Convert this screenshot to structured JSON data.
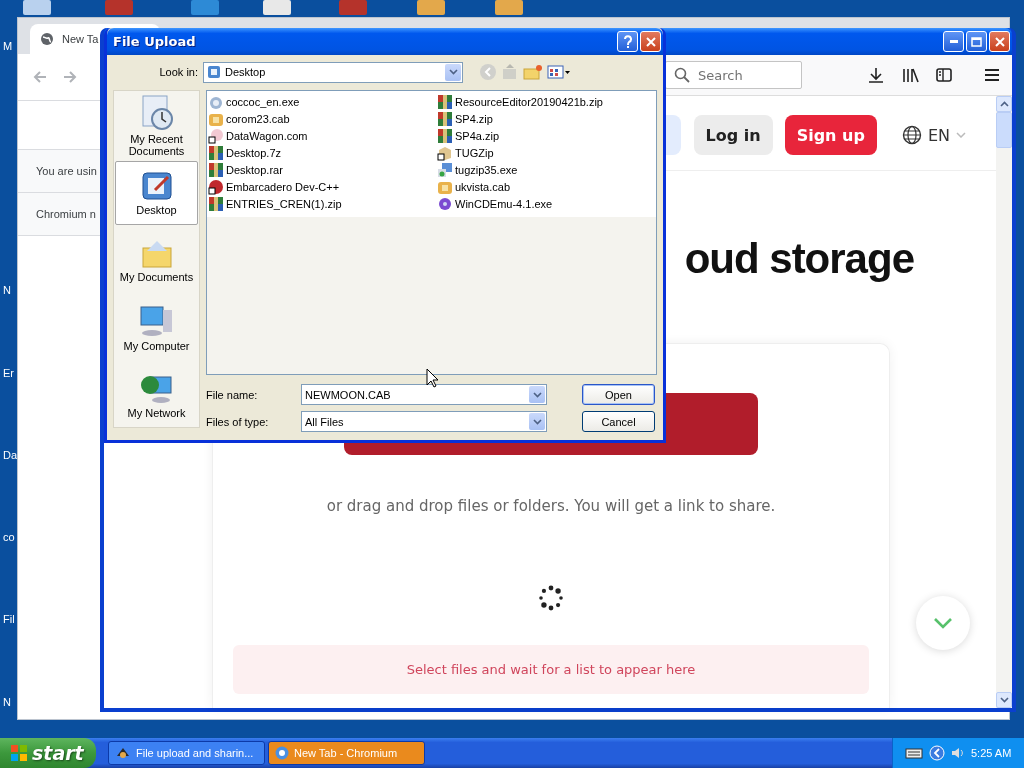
{
  "desktop": {
    "icon_labels": [
      "M",
      "N",
      "Er",
      "Da",
      "co",
      "Fil",
      "N"
    ]
  },
  "back_window": {
    "tab": {
      "label": "New Ta",
      "selected": true
    },
    "infobar_text": "You are usin",
    "notice_text": "Chromium n"
  },
  "browser": {
    "search": {
      "placeholder": "Search"
    },
    "login": "Log in",
    "signup": "Sign up",
    "language": "EN",
    "heading": "oud storage",
    "drop_hint": "or drag and drop files or folders. You will get a link to share.",
    "empty_list": "Select files and wait for a list to appear here"
  },
  "dialog": {
    "title": "File Upload",
    "look_in_label": "Look in:",
    "look_in_value": "Desktop",
    "places": [
      {
        "label": "My Recent Documents",
        "kind": "recent",
        "selected": false
      },
      {
        "label": "Desktop",
        "kind": "desktop",
        "selected": true
      },
      {
        "label": "My Documents",
        "kind": "documents",
        "selected": false
      },
      {
        "label": "My Computer",
        "kind": "computer",
        "selected": false
      },
      {
        "label": "My Network",
        "kind": "network",
        "selected": false
      }
    ],
    "files": [
      {
        "name": "coccoc_en.exe",
        "kind": "setup"
      },
      {
        "name": "corom23.cab",
        "kind": "cab"
      },
      {
        "name": "DataWagon.com",
        "kind": "shortcut"
      },
      {
        "name": "Desktop.7z",
        "kind": "archive"
      },
      {
        "name": "Desktop.rar",
        "kind": "archive"
      },
      {
        "name": "Embarcadero Dev-C++",
        "kind": "dev"
      },
      {
        "name": "ENTRIES_CREN(1).zip",
        "kind": "archive"
      },
      {
        "name": "ResourceEditor20190421b.zip",
        "kind": "archive"
      },
      {
        "name": "SP4.zip",
        "kind": "archive"
      },
      {
        "name": "SP4a.zip",
        "kind": "archive"
      },
      {
        "name": "TUGZip",
        "kind": "box"
      },
      {
        "name": "tugzip35.exe",
        "kind": "installer"
      },
      {
        "name": "ukvista.cab",
        "kind": "cab"
      },
      {
        "name": "WinCDEmu-4.1.exe",
        "kind": "disc"
      }
    ],
    "file_name_label": "File name:",
    "file_name": "NEWMOON.CAB",
    "file_type_label": "Files of type:",
    "file_type": "All Files",
    "buttons": [
      "Open",
      "Cancel"
    ]
  },
  "taskbar": {
    "start": "start",
    "tasks": [
      {
        "label": "File upload and sharin...",
        "flashing": false
      },
      {
        "label": "New Tab - Chromium",
        "flashing": true
      }
    ],
    "clock": "5:25 AM"
  }
}
